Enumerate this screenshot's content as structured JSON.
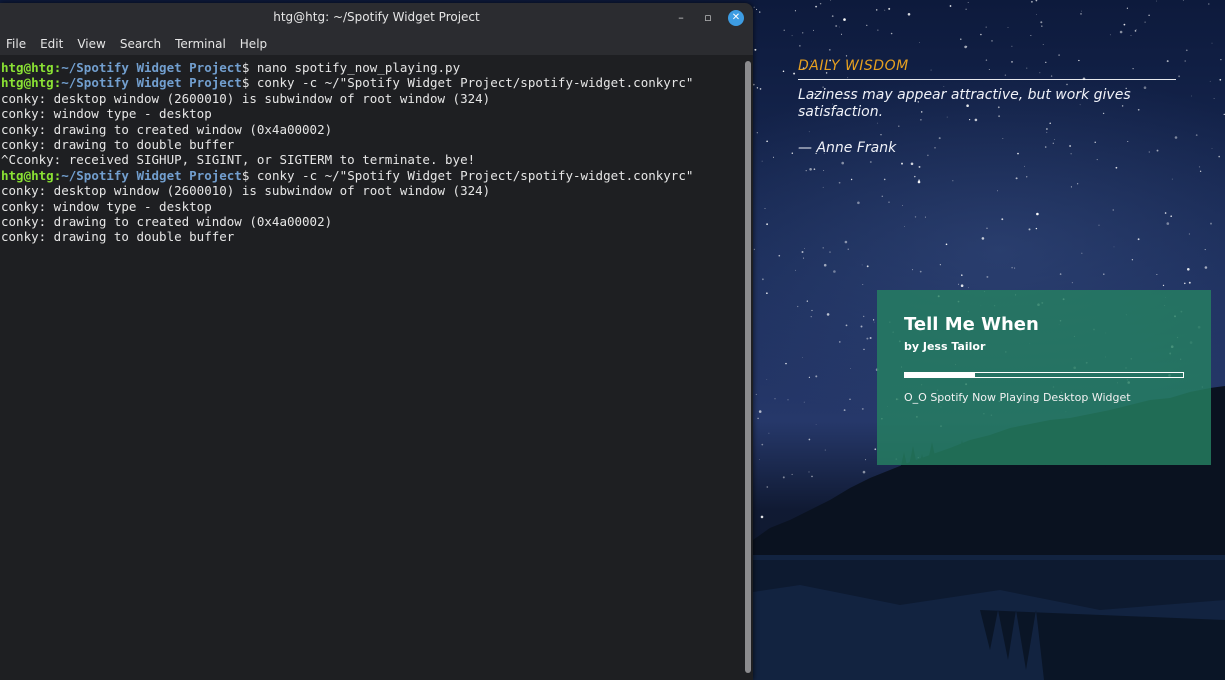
{
  "window": {
    "title": "htg@htg: ~/Spotify Widget Project",
    "buttons": {
      "minimize": "–",
      "maximize": "▫",
      "close": "✕"
    }
  },
  "menu": [
    "File",
    "Edit",
    "View",
    "Search",
    "Terminal",
    "Help"
  ],
  "prompt": {
    "user": "htg@htg",
    "sep": ":",
    "path": "~/Spotify Widget Project",
    "symbol": "$"
  },
  "terminal_lines": [
    {
      "type": "prompt",
      "cmd": " nano spotify_now_playing.py"
    },
    {
      "type": "prompt",
      "cmd": " conky -c ~/\"Spotify Widget Project/spotify-widget.conkyrc\""
    },
    {
      "type": "out",
      "text": "conky: desktop window (2600010) is subwindow of root window (324)"
    },
    {
      "type": "out",
      "text": "conky: window type - desktop"
    },
    {
      "type": "out",
      "text": "conky: drawing to created window (0x4a00002)"
    },
    {
      "type": "out",
      "text": "conky: drawing to double buffer"
    },
    {
      "type": "out",
      "text": "^Cconky: received SIGHUP, SIGINT, or SIGTERM to terminate. bye!"
    },
    {
      "type": "prompt",
      "cmd": " conky -c ~/\"Spotify Widget Project/spotify-widget.conkyrc\""
    },
    {
      "type": "out",
      "text": "conky: desktop window (2600010) is subwindow of root window (324)"
    },
    {
      "type": "out",
      "text": "conky: window type - desktop"
    },
    {
      "type": "out",
      "text": "conky: drawing to created window (0x4a00002)"
    },
    {
      "type": "out",
      "text": "conky: drawing to double buffer"
    }
  ],
  "quote_widget": {
    "title": "DAILY WISDOM",
    "text": "Laziness may appear attractive, but work gives satisfaction.",
    "author": "— Anne Frank"
  },
  "spotify_widget": {
    "track": "Tell Me When",
    "artist": "by Jess Tailor",
    "progress": 0.25,
    "caption": "O_O Spotify Now Playing Desktop Widget"
  },
  "colors": {
    "prompt_user": "#8ae234",
    "prompt_path": "#729fcf",
    "quote_title": "#e6a020",
    "spotify_bg": "#268062",
    "close_button": "#3d9ce2"
  }
}
